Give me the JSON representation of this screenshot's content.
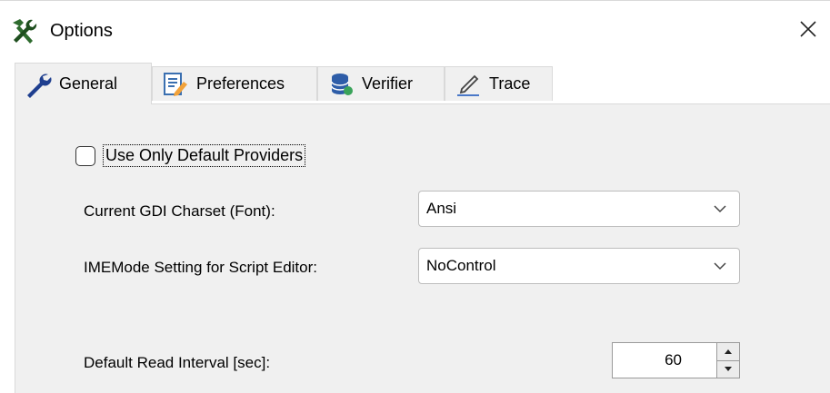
{
  "window": {
    "title": "Options",
    "app_icon": "tools-icon",
    "close_icon": "close-icon"
  },
  "tabs": [
    {
      "label": "General",
      "icon": "wrench-icon",
      "active": true
    },
    {
      "label": "Preferences",
      "icon": "edit-document-icon",
      "active": false
    },
    {
      "label": "Verifier",
      "icon": "database-icon",
      "active": false
    },
    {
      "label": "Trace",
      "icon": "pen-signature-icon",
      "active": false
    }
  ],
  "general": {
    "use_default_providers": {
      "label": "Use Only Default Providers",
      "checked": false
    },
    "gdi_charset": {
      "label": "Current GDI Charset (Font):",
      "value": "Ansi"
    },
    "ime_mode": {
      "label": "IMEMode Setting for Script Editor:",
      "value": "NoControl"
    },
    "read_interval": {
      "label": "Default Read Interval [sec]:",
      "value": "60"
    }
  },
  "colors": {
    "panel_bg": "#f0f0f0",
    "border": "#d9d9d9"
  }
}
